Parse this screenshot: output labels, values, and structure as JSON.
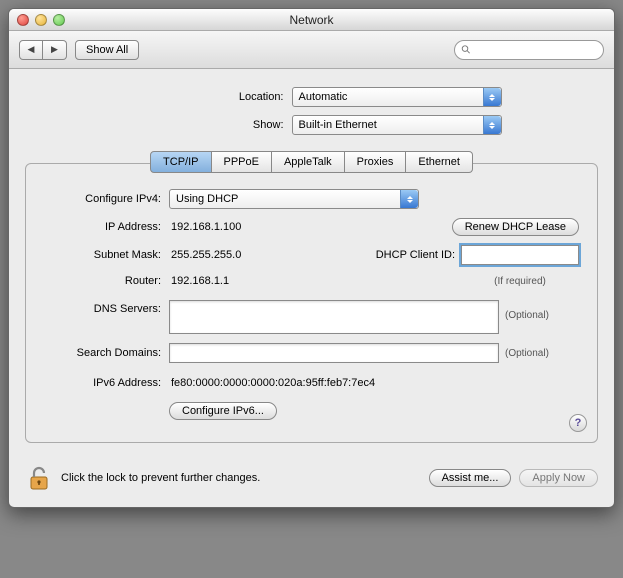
{
  "window": {
    "title": "Network"
  },
  "toolbar": {
    "show_all": "Show All",
    "search_placeholder": ""
  },
  "location": {
    "label": "Location:",
    "value": "Automatic"
  },
  "show": {
    "label": "Show:",
    "value": "Built-in Ethernet"
  },
  "tabs": [
    "TCP/IP",
    "PPPoE",
    "AppleTalk",
    "Proxies",
    "Ethernet"
  ],
  "active_tab": 0,
  "panel": {
    "configure_ipv4": {
      "label": "Configure IPv4:",
      "value": "Using DHCP"
    },
    "ip": {
      "label": "IP Address:",
      "value": "192.168.1.100"
    },
    "renew": "Renew DHCP Lease",
    "subnet": {
      "label": "Subnet Mask:",
      "value": "255.255.255.0"
    },
    "dhcp_client": {
      "label": "DHCP Client ID:",
      "value": "",
      "hint": "(If required)"
    },
    "router": {
      "label": "Router:",
      "value": "192.168.1.1"
    },
    "dns": {
      "label": "DNS Servers:",
      "value": "",
      "hint": "(Optional)"
    },
    "search_domains": {
      "label": "Search Domains:",
      "value": "",
      "hint": "(Optional)"
    },
    "ipv6": {
      "label": "IPv6 Address:",
      "value": "fe80:0000:0000:0000:020a:95ff:feb7:7ec4"
    },
    "configure_ipv6_btn": "Configure IPv6..."
  },
  "footer": {
    "lock_text": "Click the lock to prevent further changes.",
    "assist": "Assist me...",
    "apply": "Apply Now"
  }
}
